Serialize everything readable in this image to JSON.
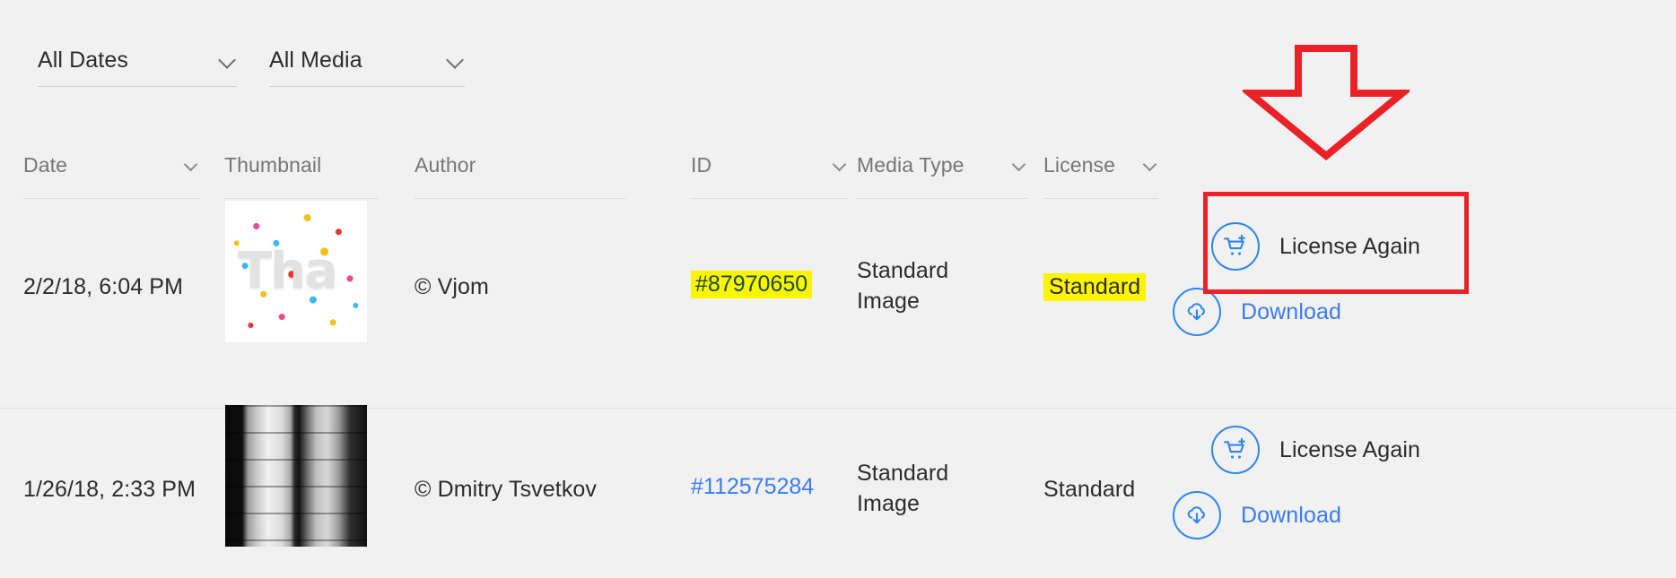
{
  "filters": [
    {
      "name": "all-dates",
      "label": "All Dates",
      "icon": "chevron-down-icon"
    },
    {
      "name": "all-media",
      "label": "All Media",
      "icon": "chevron-down-icon"
    }
  ],
  "table": {
    "columns": [
      {
        "key": "date",
        "label": "Date",
        "sortable": true
      },
      {
        "key": "thumbnail",
        "label": "Thumbnail",
        "sortable": false
      },
      {
        "key": "author",
        "label": "Author",
        "sortable": false
      },
      {
        "key": "id",
        "label": "ID",
        "sortable": true
      },
      {
        "key": "mediatype",
        "label": "Media Type",
        "sortable": true
      },
      {
        "key": "license",
        "label": "License",
        "sortable": true
      }
    ],
    "rows": [
      {
        "date": "2/2/18, 6:04 PM",
        "thumbnail_alt": "confetti-Tha-thumbnail",
        "author": "© Vjom",
        "id": "#87970650",
        "id_highlighted": true,
        "media_type_line1": "Standard",
        "media_type_line2": "Image",
        "license": "Standard",
        "license_highlighted": true,
        "actions": [
          {
            "name": "license-again-button",
            "label": "License Again",
            "icon": "cart-plus-icon",
            "style": "dark"
          },
          {
            "name": "download-button",
            "label": "Download",
            "icon": "cloud-download-icon",
            "style": "blue"
          }
        ]
      },
      {
        "date": "1/26/18, 2:33 PM",
        "thumbnail_alt": "black-and-white-columns-thumbnail",
        "author": "© Dmitry Tsvetkov",
        "id": "#112575284",
        "id_highlighted": false,
        "media_type_line1": "Standard",
        "media_type_line2": "Image",
        "license": "Standard",
        "license_highlighted": false,
        "actions": [
          {
            "name": "license-again-button",
            "label": "License Again",
            "icon": "cart-plus-icon",
            "style": "dark"
          },
          {
            "name": "download-button",
            "label": "Download",
            "icon": "cloud-download-icon",
            "style": "blue"
          }
        ]
      }
    ]
  },
  "annotations": {
    "arrow": {
      "name": "red-down-arrow-annotation",
      "direction": "down",
      "color": "#ea2227"
    },
    "rect": {
      "name": "red-highlight-rectangle-annotation",
      "target": "license-again-button",
      "color": "#ea2227"
    }
  },
  "colors": {
    "page_background": "#f1f1f1",
    "accent_blue": "#3a7cf0",
    "icon_blue": "#2f86f0",
    "highlight_yellow": "#fbf504",
    "annotation_red": "#ea2227",
    "header_text": "#767676",
    "body_text": "#2c2c2c"
  }
}
